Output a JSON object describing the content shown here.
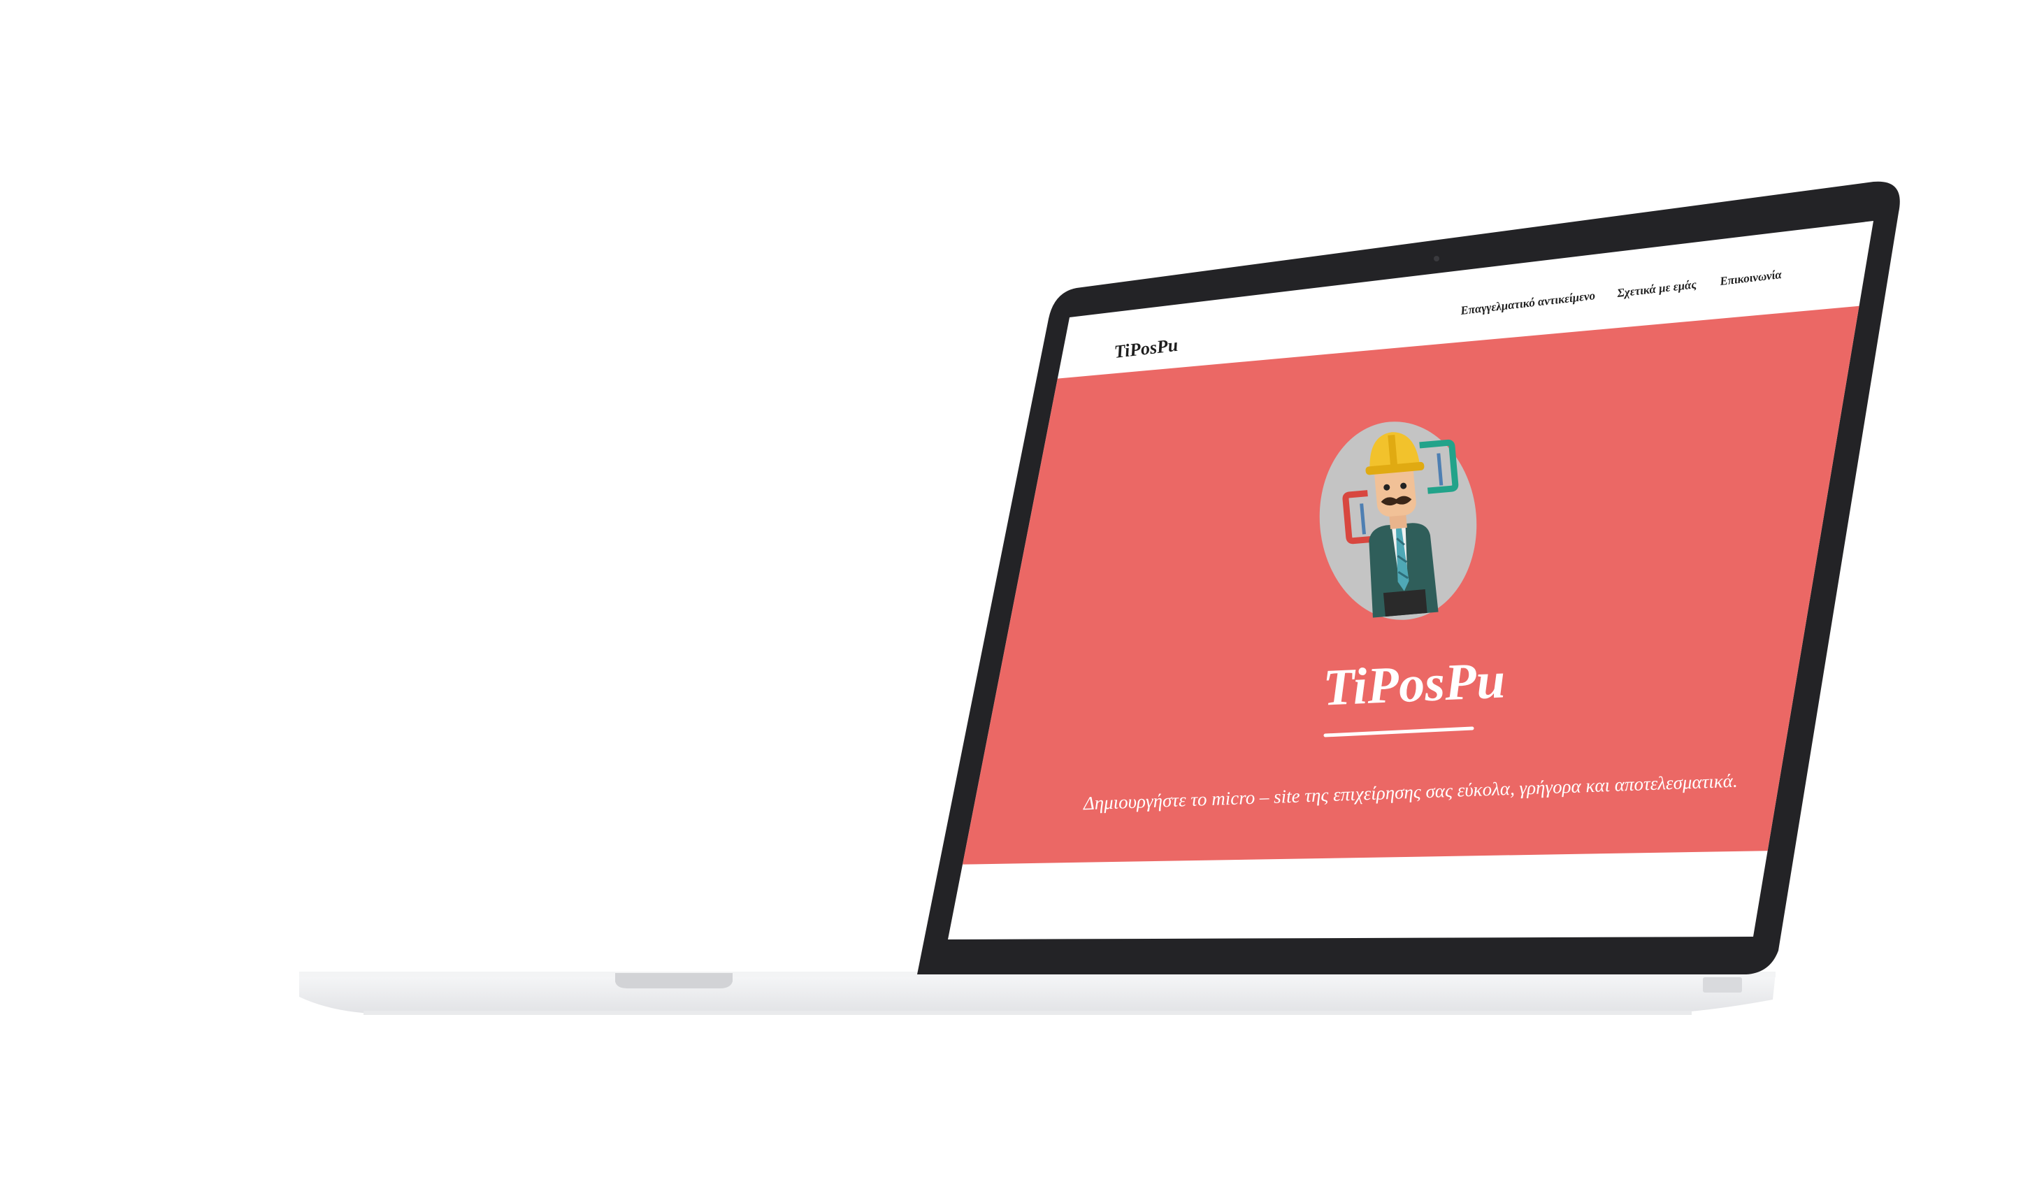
{
  "site": {
    "brand": "TiPosPu",
    "hero_title": "TiPosPu",
    "tagline": "Δημιουργήστε το micro – site της επιχείρησης σας εύκολα, γρήγορα και αποτελεσματικά.",
    "nav": [
      {
        "label": "Επαγγελματικό αντικείμενο"
      },
      {
        "label": "Σχετικά με εμάς"
      },
      {
        "label": "Επικοινωνία"
      }
    ]
  },
  "colors": {
    "hero_background": "#EB6865",
    "bezel": "#232326",
    "page_background": "#FFFFFF",
    "avatar_circle": "#C4C4C4",
    "laptop_base": "#EFF0F2",
    "text_dark": "#1E1E1E",
    "text_light": "#FFFFFF"
  },
  "icons": {
    "avatar": "construction-worker-mascot-icon"
  }
}
